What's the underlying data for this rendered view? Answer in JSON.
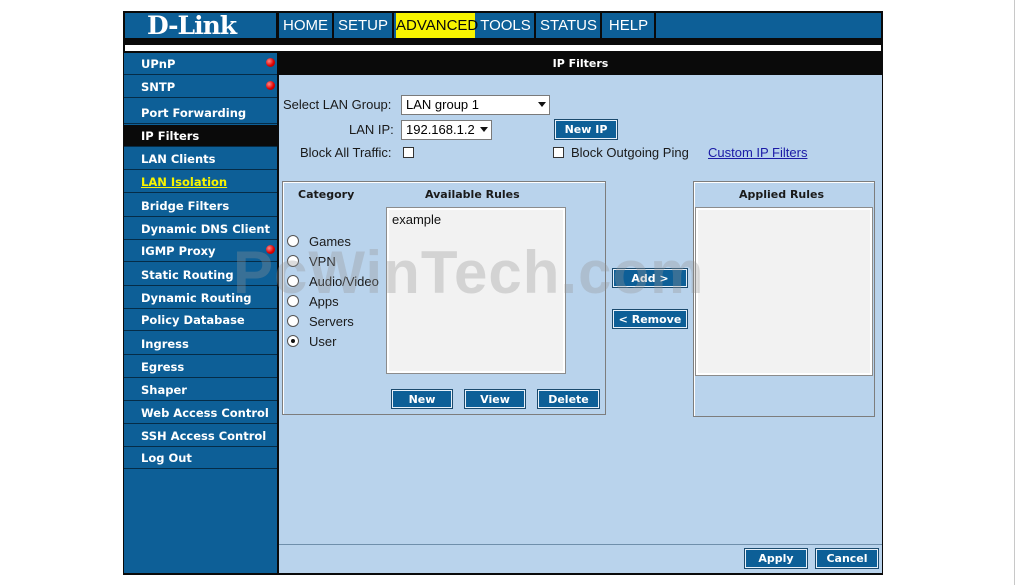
{
  "header": {
    "logo": "D-Link",
    "nav": [
      "HOME",
      "SETUP",
      "ADVANCED",
      "TOOLS",
      "STATUS",
      "HELP"
    ],
    "active_tab": "ADVANCED"
  },
  "sidebar": {
    "items": [
      {
        "label": "UPnP"
      },
      {
        "label": "SNTP"
      },
      {
        "label": "Port Forwarding"
      },
      {
        "label": "IP Filters"
      },
      {
        "label": "LAN Clients"
      },
      {
        "label": "LAN Isolation"
      },
      {
        "label": "Bridge Filters"
      },
      {
        "label": "Dynamic DNS Client"
      },
      {
        "label": "IGMP Proxy"
      },
      {
        "label": "Static Routing"
      },
      {
        "label": "Dynamic Routing"
      },
      {
        "label": "Policy Database"
      },
      {
        "label": "Ingress"
      },
      {
        "label": "Egress"
      },
      {
        "label": "Shaper"
      },
      {
        "label": "Web Access Control"
      },
      {
        "label": "SSH Access Control"
      },
      {
        "label": "Log Out"
      }
    ],
    "selected": "IP Filters",
    "status_dots_on": [
      "UPnP",
      "SNTP",
      "IGMP Proxy"
    ]
  },
  "main": {
    "title": "IP Filters",
    "lan_group_label": "Select LAN Group:",
    "lan_group_value": "LAN group 1",
    "lan_ip_label": "LAN IP:",
    "lan_ip_value": "192.168.1.2",
    "new_ip_button": "New IP",
    "block_all_label": "Block All Traffic:",
    "block_all_checked": false,
    "block_ping_label": "Block Outgoing Ping",
    "block_ping_checked": false,
    "custom_link": "Custom IP Filters",
    "category_header": "Category",
    "available_header": "Available Rules",
    "applied_header": "Applied Rules",
    "categories": [
      "Games",
      "VPN",
      "Audio/Video",
      "Apps",
      "Servers",
      "User"
    ],
    "selected_category": "User",
    "available_rules": [
      "example"
    ],
    "applied_rules": [],
    "add_button": "Add >",
    "remove_button": "< Remove",
    "new_button": "New",
    "view_button": "View",
    "delete_button": "Delete",
    "apply_button": "Apply",
    "cancel_button": "Cancel"
  },
  "watermark": "PcWinTech.com",
  "colors": {
    "brand_blue": "#0d5f97",
    "panel_bg": "#b9d3ec",
    "active_tab": "#f8f400",
    "link_yellow": "#f8f400",
    "status_dot": "#e00000"
  }
}
